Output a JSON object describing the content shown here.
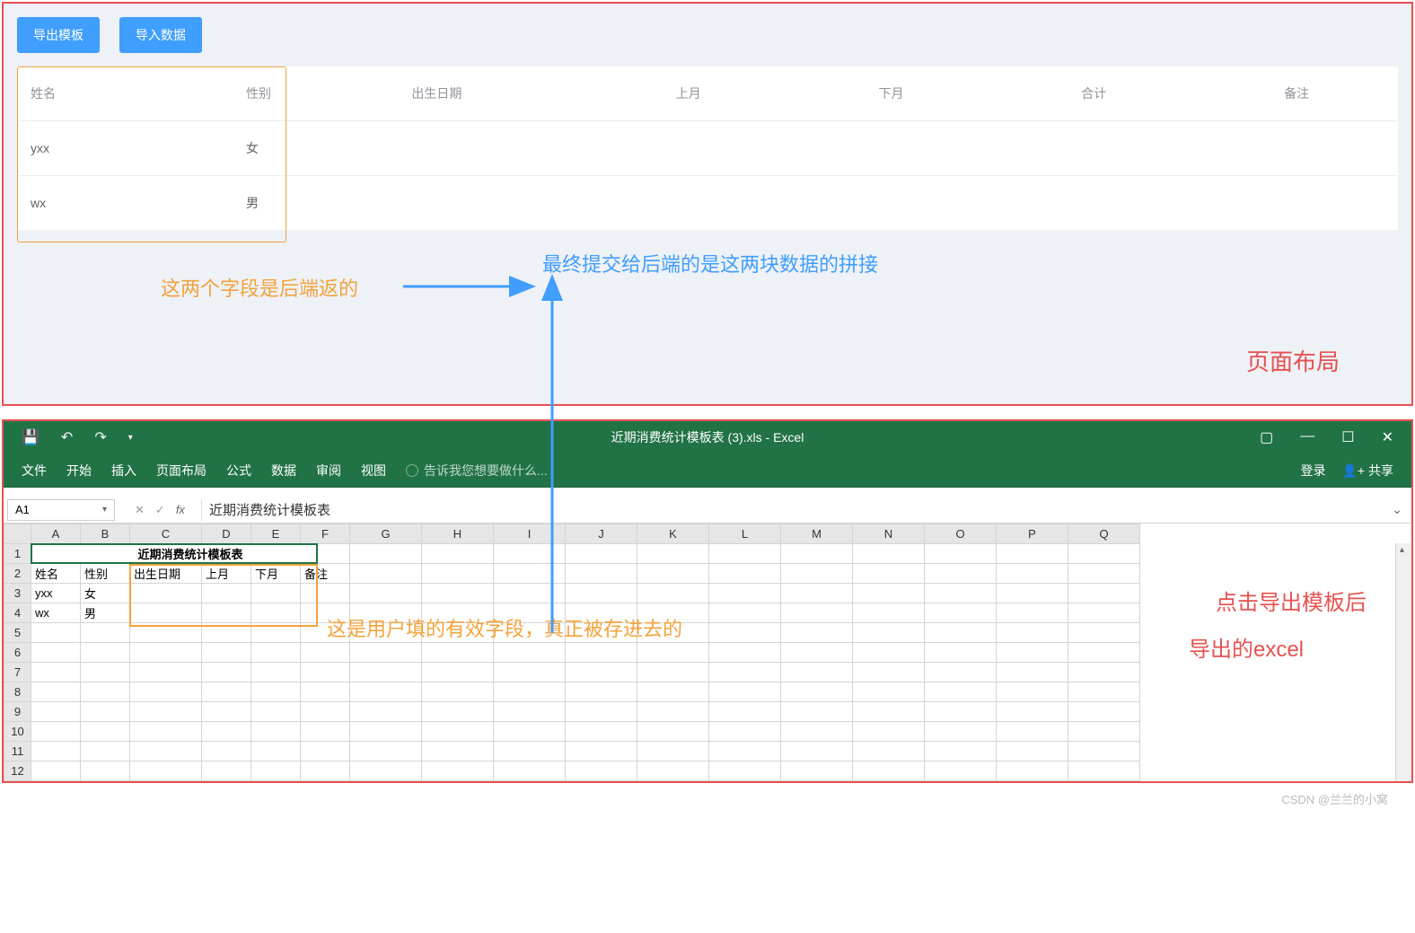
{
  "top": {
    "buttons": {
      "export": "导出模板",
      "import": "导入数据"
    },
    "headers": [
      "姓名",
      "性别",
      "出生日期",
      "上月",
      "下月",
      "合计",
      "备注"
    ],
    "rows": [
      {
        "name": "yxx",
        "sex": "女"
      },
      {
        "name": "wx",
        "sex": "男"
      }
    ],
    "annot_orange": "这两个字段是后端返的",
    "annot_blue": "最终提交给后端的是这两块数据的拼接",
    "annot_red": "页面布局"
  },
  "excel": {
    "title": "近期消费统计模板表 (3).xls - Excel",
    "tabs": [
      "文件",
      "开始",
      "插入",
      "页面布局",
      "公式",
      "数据",
      "审阅",
      "视图"
    ],
    "tell_me": "告诉我您想要做什么...",
    "login": "登录",
    "share": "共享",
    "name_box": "A1",
    "formula": "近期消费统计模板表",
    "col_letters": [
      "A",
      "B",
      "C",
      "D",
      "E",
      "F",
      "G",
      "H",
      "I",
      "J",
      "K",
      "L",
      "M",
      "N",
      "O",
      "P",
      "Q"
    ],
    "row_nums": [
      "1",
      "2",
      "3",
      "4",
      "5",
      "6",
      "7",
      "8",
      "9",
      "10",
      "11",
      "12"
    ],
    "sheet_title": "近期消费统计模板表",
    "sheet_headers": [
      "姓名",
      "性别",
      "出生日期",
      "上月",
      "下月",
      "备注"
    ],
    "sheet_rows": [
      [
        "yxx",
        "女",
        "",
        "",
        "",
        ""
      ],
      [
        "wx",
        "男",
        "",
        "",
        "",
        ""
      ]
    ],
    "annot_orange": "这是用户填的有效字段，真正被存进去的",
    "annot_red1": "点击导出模板后",
    "annot_red2": "导出的excel"
  },
  "chart_data": {
    "type": "table",
    "title": "近期消费统计模板表",
    "columns": [
      "姓名",
      "性别",
      "出生日期",
      "上月",
      "下月",
      "备注"
    ],
    "rows": [
      {
        "姓名": "yxx",
        "性别": "女",
        "出生日期": "",
        "上月": "",
        "下月": "",
        "备注": ""
      },
      {
        "姓名": "wx",
        "性别": "男",
        "出生日期": "",
        "上月": "",
        "下月": "",
        "备注": ""
      }
    ]
  },
  "footer": "CSDN @兰兰的小窝"
}
